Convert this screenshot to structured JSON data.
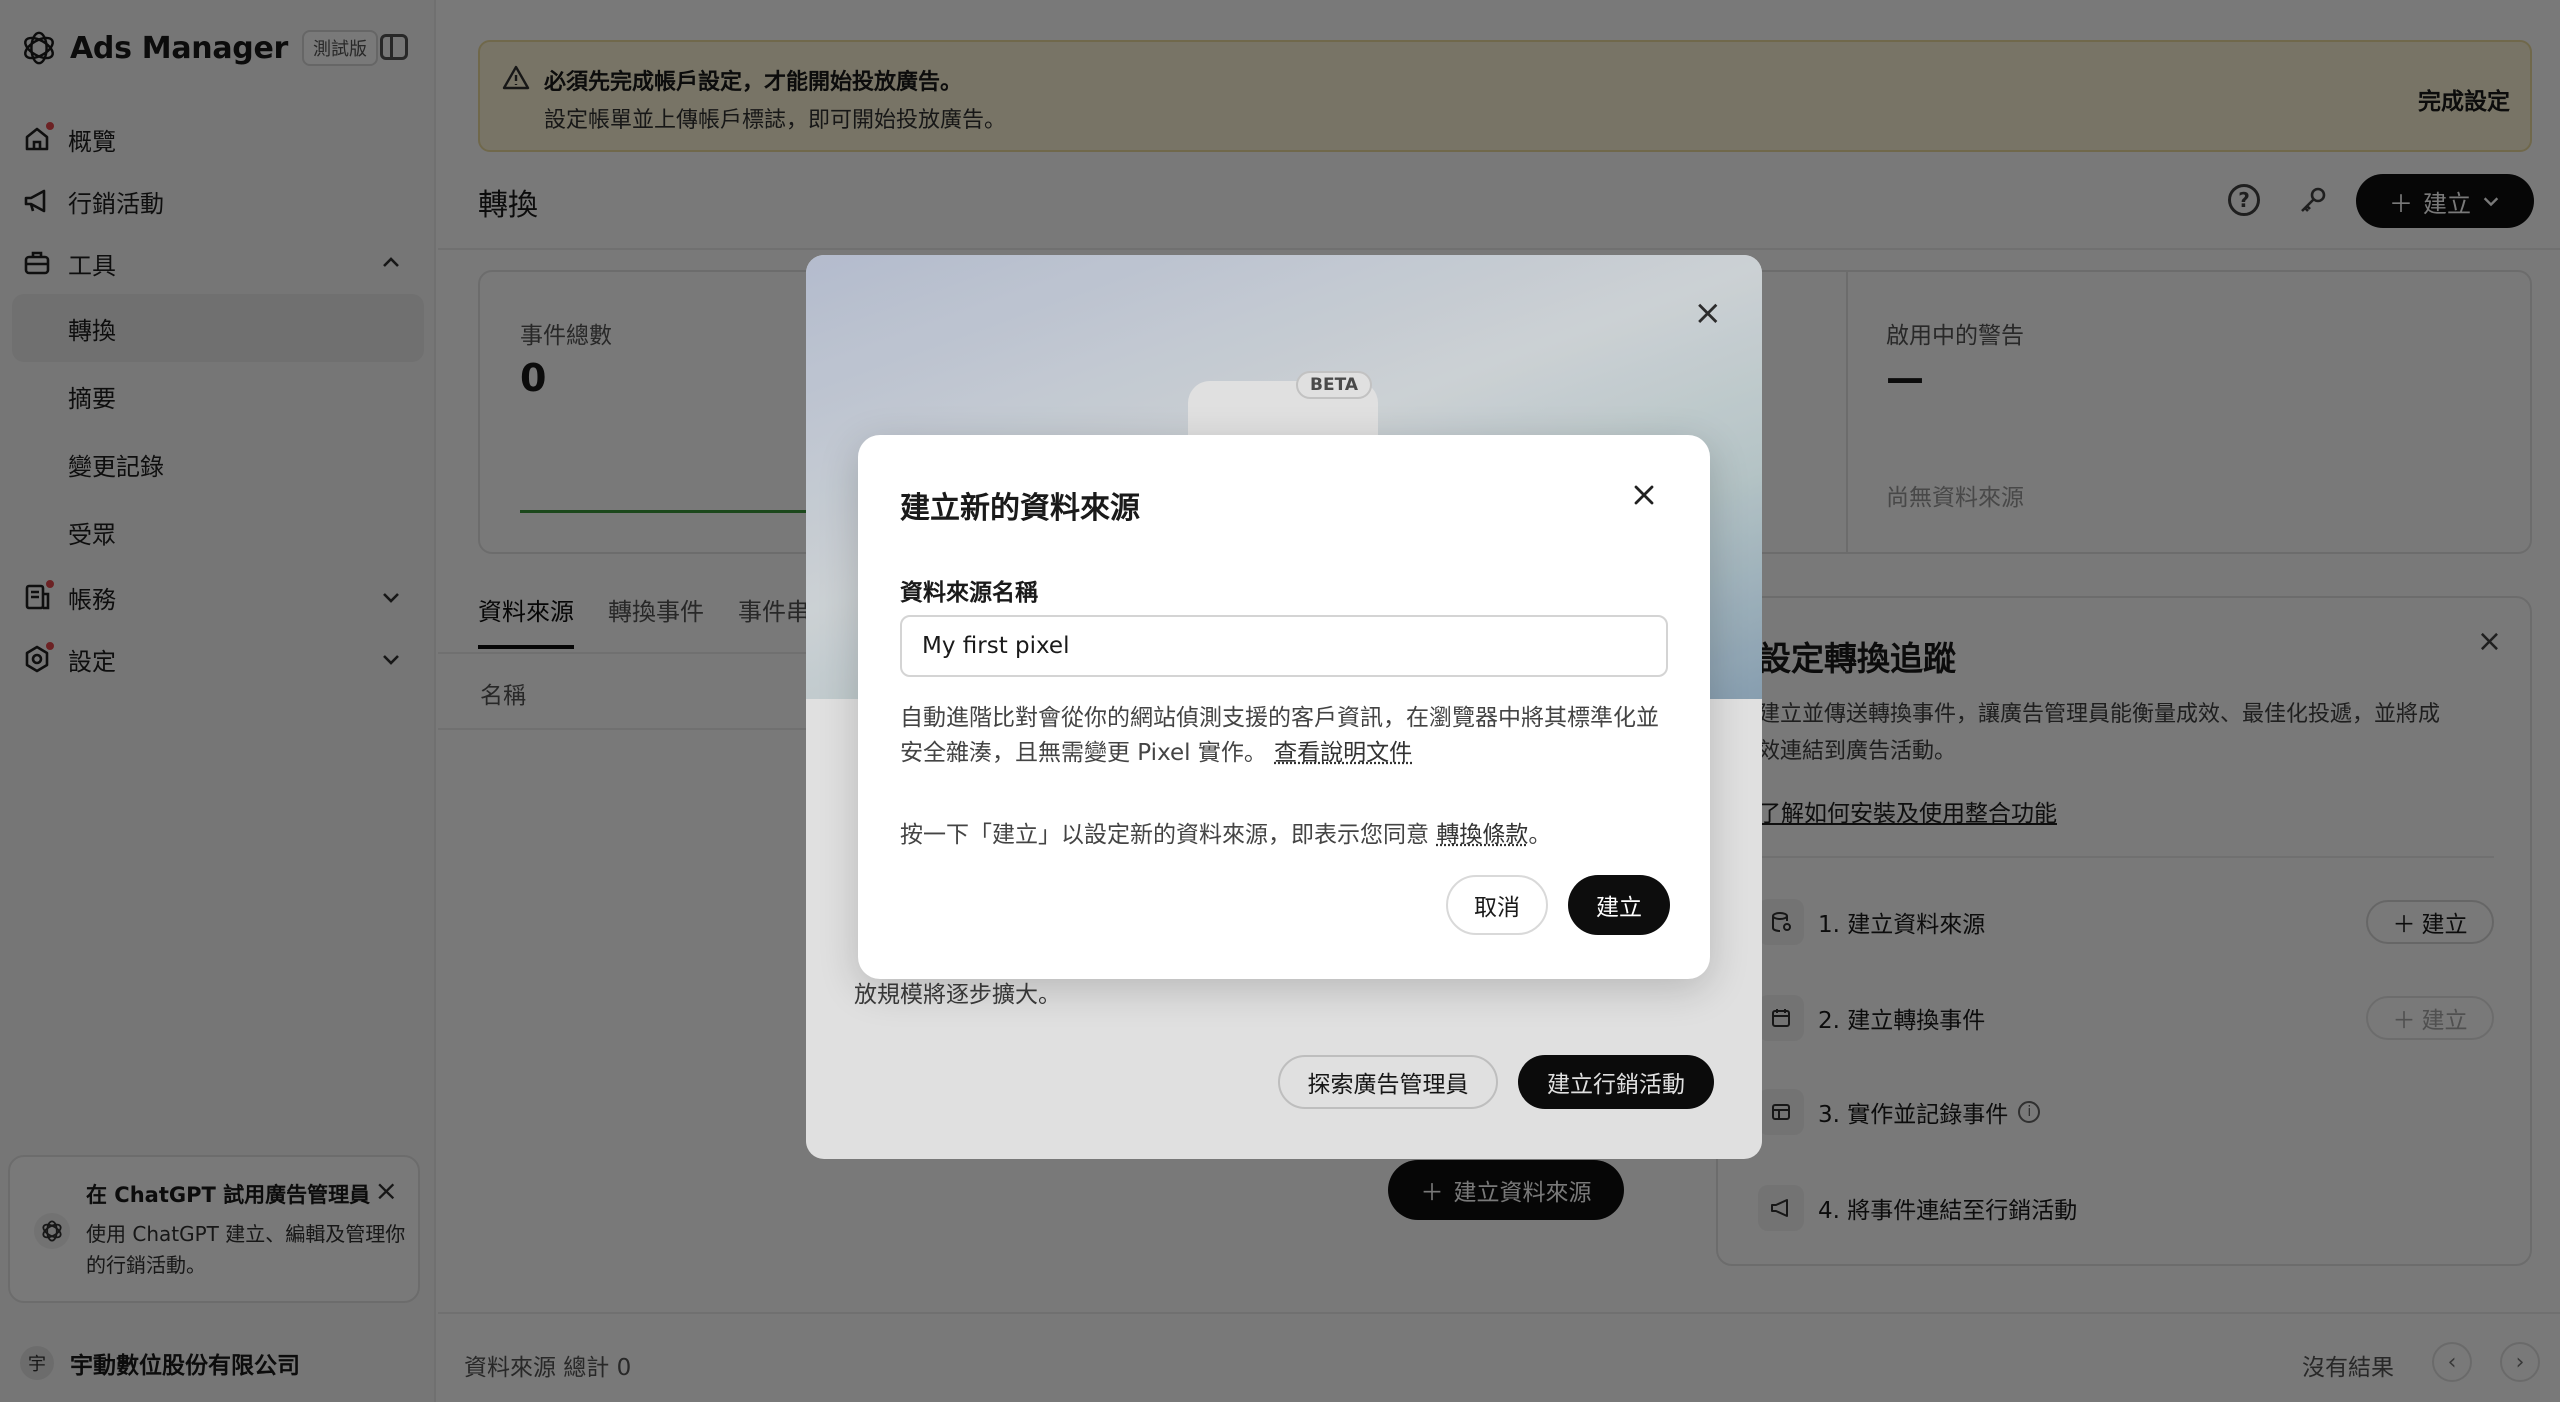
{
  "app": {
    "name": "Ads Manager",
    "badge": "測試版"
  },
  "sidebar": {
    "items": [
      {
        "label": "概覽",
        "icon": "home-icon",
        "alert": true
      },
      {
        "label": "行銷活動",
        "icon": "megaphone-icon",
        "alert": false
      },
      {
        "label": "工具",
        "icon": "toolbox-icon",
        "alert": false,
        "expanded": true
      },
      {
        "label": "帳務",
        "icon": "receipt-icon",
        "alert": true,
        "expanded": false
      },
      {
        "label": "設定",
        "icon": "gear-icon",
        "alert": true,
        "expanded": false
      }
    ],
    "tools_sub": [
      {
        "label": "轉換",
        "active": true
      },
      {
        "label": "摘要",
        "active": false
      },
      {
        "label": "變更記錄",
        "active": false
      },
      {
        "label": "受眾",
        "active": false
      }
    ],
    "promo": {
      "title": "在 ChatGPT 試用廣告管理員",
      "text": "使用 ChatGPT 建立、編輯及管理你的行銷活動。"
    },
    "account": {
      "avatar": "宇",
      "name": "宇動數位股份有限公司"
    }
  },
  "banner": {
    "title": "必須先完成帳戶設定，才能開始投放廣告。",
    "text": "設定帳單並上傳帳戶標誌，即可開始投放廣告。",
    "action": "完成設定"
  },
  "header": {
    "title": "轉換",
    "create_label": "建立"
  },
  "stats": {
    "total_label": "事件總數",
    "total_value": "0",
    "alerts_label": "啟用中的警告",
    "alerts_value": "—",
    "alerts_empty": "尚無資料來源"
  },
  "tabs": [
    "資料來源",
    "轉換事件",
    "事件串"
  ],
  "table": {
    "column_name": "名稱",
    "empty_create": "建立資料來源"
  },
  "setup": {
    "title": "設定轉換追蹤",
    "desc": "建立並傳送轉換事件，讓廣告管理員能衡量成效、最佳化投遞，並將成效連結到廣告活動。",
    "link": "了解如何安裝及使用整合功能",
    "steps": [
      {
        "label": "1. 建立資料來源",
        "button": "建立",
        "enabled": true
      },
      {
        "label": "2. 建立轉換事件",
        "button": "建立",
        "enabled": false
      },
      {
        "label": "3. 實作並記錄事件",
        "info": true
      },
      {
        "label": "4. 將事件連結至行銷活動"
      }
    ]
  },
  "footer": {
    "total": "資料來源 總計 0",
    "empty": "沒有結果"
  },
  "back_modal": {
    "beta": "BETA",
    "text_tail": "放規模將逐步擴大。",
    "explore": "探索廣告管理員",
    "create_campaign": "建立行銷活動"
  },
  "dialog": {
    "title": "建立新的資料來源",
    "field_label": "資料來源名稱",
    "field_value": "My first pixel",
    "desc": "自動進階比對會從你的網站偵測支援的客戶資訊，在瀏覽器中將其標準化並安全雜湊，且無需變更 Pixel 實作。",
    "desc_link": "查看說明文件",
    "terms_prefix": "按一下「建立」以設定新的資料來源，即表示您同意",
    "terms_link": "轉換條款",
    "terms_suffix": "。",
    "cancel": "取消",
    "create": "建立"
  }
}
